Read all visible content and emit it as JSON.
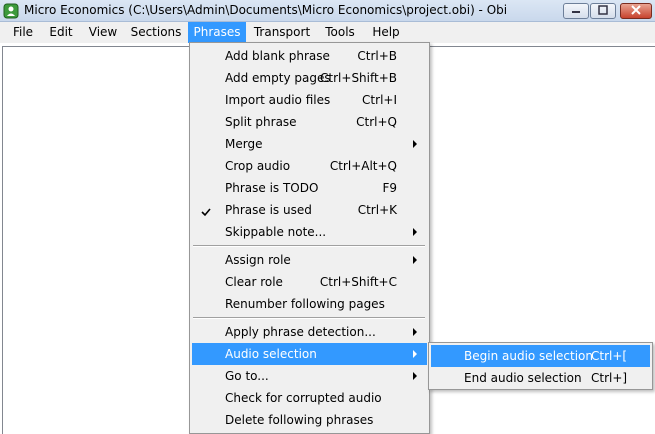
{
  "window": {
    "title": "Micro Economics (C:\\Users\\Admin\\Documents\\Micro Economics\\project.obi) - Obi",
    "icon": "obi-app-icon",
    "controls": [
      "minimize-icon",
      "maximize-icon",
      "close-icon"
    ]
  },
  "menubar": {
    "items": [
      "File",
      "Edit",
      "View",
      "Sections",
      "Phrases",
      "Transport",
      "Tools",
      "Help"
    ],
    "active": "Phrases"
  },
  "phrases_menu": {
    "items": [
      {
        "label": "Add blank phrase",
        "shortcut": "Ctrl+B"
      },
      {
        "label": "Add empty pages",
        "shortcut": "Ctrl+Shift+B"
      },
      {
        "label": "Import audio files",
        "shortcut": "Ctrl+I"
      },
      {
        "label": "Split phrase",
        "shortcut": "Ctrl+Q"
      },
      {
        "label": "Merge",
        "shortcut": "",
        "submenu": true
      },
      {
        "label": "Crop audio",
        "shortcut": "Ctrl+Alt+Q"
      },
      {
        "label": "Phrase is TODO",
        "shortcut": "F9"
      },
      {
        "label": "Phrase is used",
        "shortcut": "Ctrl+K",
        "checked": true
      },
      {
        "label": "Skippable note...",
        "shortcut": "",
        "submenu": true
      },
      {
        "label": "Assign role",
        "shortcut": "",
        "submenu": true
      },
      {
        "label": "Clear role",
        "shortcut": "Ctrl+Shift+C"
      },
      {
        "label": "Renumber following pages",
        "shortcut": ""
      },
      {
        "label": "Apply phrase detection...",
        "shortcut": "",
        "submenu": true
      },
      {
        "label": "Audio selection",
        "shortcut": "",
        "submenu": true,
        "highlighted": true
      },
      {
        "label": "Go to...",
        "shortcut": "",
        "submenu": true
      },
      {
        "label": "Check for corrupted audio",
        "shortcut": ""
      },
      {
        "label": "Delete following phrases",
        "shortcut": ""
      }
    ]
  },
  "audio_selection_submenu": {
    "items": [
      {
        "label": "Begin audio selection",
        "shortcut": "Ctrl+[",
        "highlighted": true
      },
      {
        "label": "End audio selection",
        "shortcut": "Ctrl+]"
      }
    ]
  },
  "colors": {
    "highlight": "#3399ff",
    "menu_bg": "#f0f0f0",
    "titlebar": "#c9d8ec",
    "close_button": "#c7432e"
  }
}
